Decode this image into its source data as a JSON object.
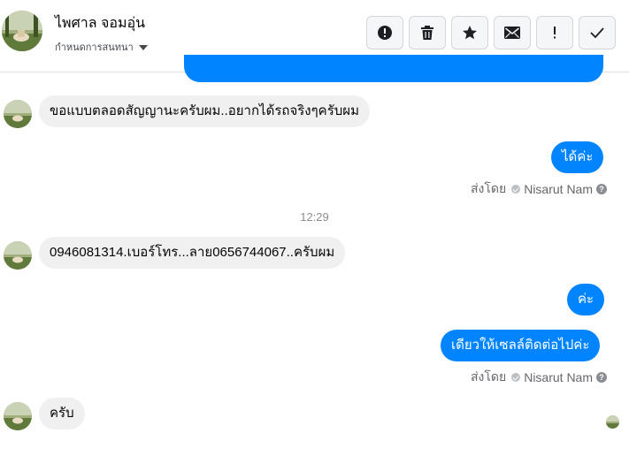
{
  "header": {
    "contact_name": "ไพศาล จอมอุ่น",
    "conversation_settings": "กำหนดการสนทนา",
    "toolbar": [
      {
        "icon": "alert-circle-icon",
        "label": "report"
      },
      {
        "icon": "trash-icon",
        "label": "delete"
      },
      {
        "icon": "star-icon",
        "label": "star"
      },
      {
        "icon": "envelope-icon",
        "label": "mark unread"
      },
      {
        "icon": "exclamation-icon",
        "label": "spam"
      },
      {
        "icon": "checkmark-icon",
        "label": "mark done"
      }
    ]
  },
  "messages": [
    {
      "direction": "in",
      "text": "ขอแบบตลอดสัญญานะครับผม..อยากได้รถจริงๆครับผม"
    },
    {
      "direction": "out",
      "text": "ได้ค่ะ"
    },
    {
      "direction": "in",
      "text": "0946081314.เบอร์โทร...ลาย0656744067..ครับผม"
    },
    {
      "direction": "out",
      "text": "ค่ะ"
    },
    {
      "direction": "out",
      "text": "เดียวให้เซลล์ติดต่อไปค่ะ"
    },
    {
      "direction": "in",
      "text": "ครับ"
    }
  ],
  "sent_by": {
    "prefix": "ส่งโดย",
    "name": "Nisarut Nam",
    "help": "?"
  },
  "timestamp": "12:29",
  "colors": {
    "outgoing_bubble": "#0084ff",
    "incoming_bubble": "#f0f0f0",
    "meta_text": "#65676b"
  }
}
